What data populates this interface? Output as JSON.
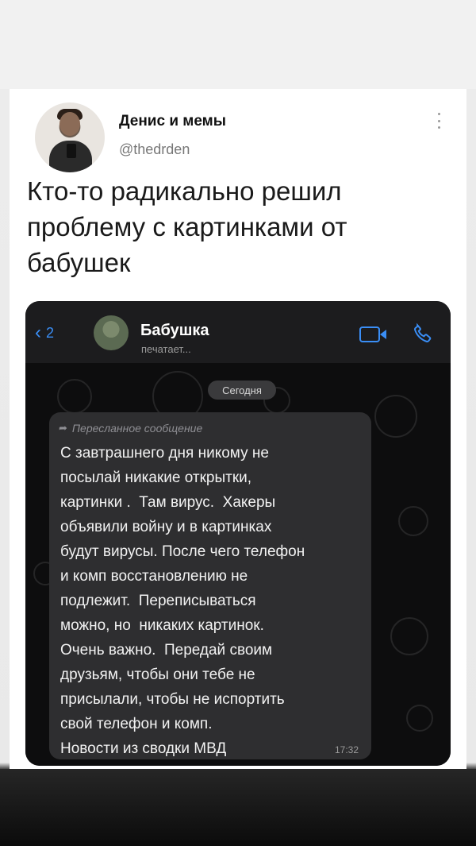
{
  "tweet": {
    "name": "Денис и мемы",
    "handle": "@thedrden",
    "text": "Кто-то радикально решил проблему с картинками от бабушек"
  },
  "chat": {
    "back_count": "2",
    "contact_name": "Бабушка",
    "contact_status": "печатает...",
    "date": "Сегодня",
    "forwarded_label": "Пересланное сообщение",
    "message": "С завтрашнего дня никому не\nпосылай никакие открытки,\nкартинки .  Там вирус.  Хакеры\nобъявили войну и в картинках\nбудут вирусы. После чего телефон\nи комп восстановлению не\nподлежит.  Переписываться\nможно, но  никаких картинок.\nОчень важно.  Передай своим\nдрузьям, чтобы они тебе не\nприсылали, чтобы не испортить\nсвой телефон и комп.\nНовости из сводки МВД",
    "time": "17:32"
  },
  "colors": {
    "accent": "#3a8ef6",
    "bubble": "#2e2e30",
    "chat_bg": "#0d0d0e"
  },
  "icons": [
    "back-chevron-icon",
    "video-call-icon",
    "phone-icon",
    "more-dots-icon",
    "forward-arrow-icon"
  ]
}
